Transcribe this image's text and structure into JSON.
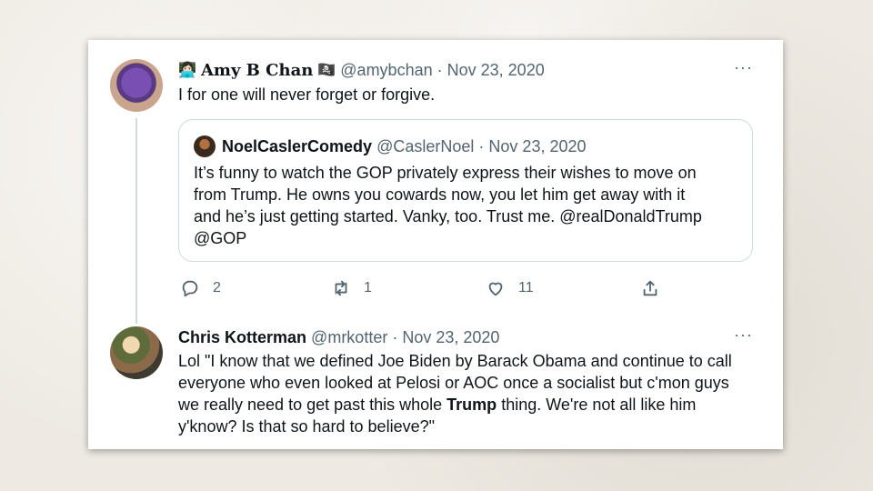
{
  "tweet1": {
    "display_name": "Amy B Chan",
    "handle": "@amybchan",
    "date": "Nov 23, 2020",
    "separator": "·",
    "more": "···",
    "text": "I for one will never forget or forgive.",
    "quote": {
      "display_name": "NoelCaslerComedy",
      "handle": "@CaslerNoel",
      "date": "Nov 23, 2020",
      "lines": [
        "It’s funny to watch the GOP privately express their wishes to move on",
        "from Trump. He owns you cowards now, you let him get away with it",
        "and he’s just getting started. Vanky, too. Trust me. @realDonaldTrump",
        "@GOP"
      ]
    },
    "actions": {
      "reply_count": "2",
      "retweet_count": "1",
      "like_count": "11"
    }
  },
  "tweet2": {
    "display_name": "Chris Kotterman",
    "handle": "@mrkotter",
    "date": "Nov 23, 2020",
    "more": "···",
    "line1": "Lol \"I know that we defined Joe Biden by Barack Obama and continue to call",
    "line2": "everyone who even looked at Pelosi or AOC once a socialist but c'mon guys",
    "line3_before": "we really need to get past this whole ",
    "line3_bold": "Trump",
    "line3_after": " thing. We're not all like him",
    "line4": "y'know? Is that so hard to believe?\""
  }
}
